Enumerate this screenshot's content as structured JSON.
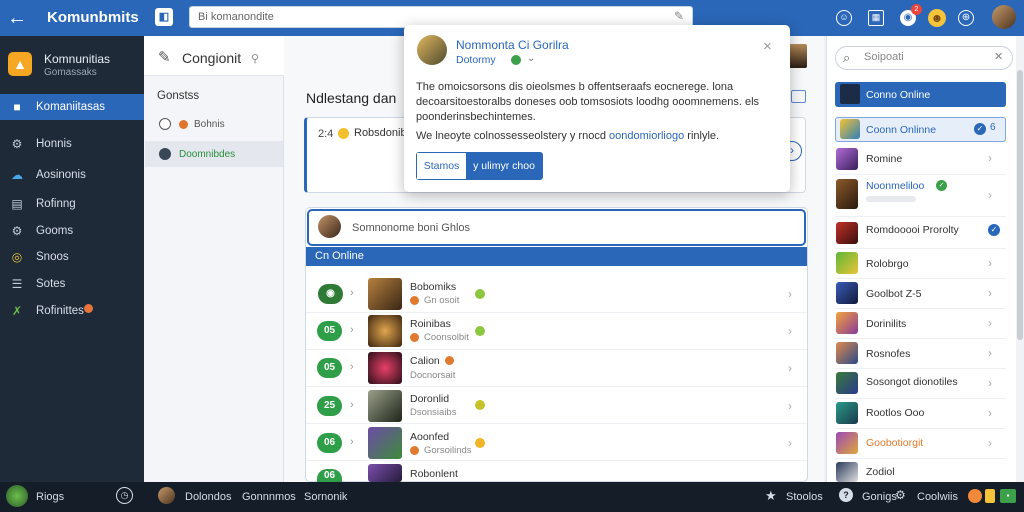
{
  "topbar": {
    "app_title": "Komunbmits",
    "search_placeholder": "Bi komanondite",
    "notification_count": "2",
    "colors": {
      "bar": "#2a67b8"
    }
  },
  "sidebar": {
    "brand_name": "Komnunitias",
    "brand_sub": "Gomassaks",
    "items": [
      {
        "label": "Komaniitasas",
        "icon": "group-icon",
        "active": true
      },
      {
        "label": "Honnis",
        "icon": "gear-icon"
      },
      {
        "label": "Aosinonis",
        "icon": "cloud-icon"
      },
      {
        "label": "Rofinng",
        "icon": "folder-icon"
      },
      {
        "label": "Gooms",
        "icon": "gear-icon"
      },
      {
        "label": "Snoos",
        "icon": "coin-icon"
      },
      {
        "label": "Sotes",
        "icon": "list-icon"
      },
      {
        "label": "Rofinittes",
        "icon": "wand-icon"
      }
    ]
  },
  "col2": {
    "title": "Congionit",
    "section": "Gonstss",
    "rows": [
      {
        "label": "Bohnis",
        "dot_color": "#e0762c"
      },
      {
        "label": "Doomnibdes",
        "dot_color": "#3a4756"
      }
    ]
  },
  "main": {
    "heading": "Ndlestang dan",
    "topcard": {
      "num": "2:4",
      "text": "Robsdonibks"
    },
    "list_search": "Somnonome boni Ghlos",
    "band": "Cn Online",
    "rows": [
      {
        "badge": "",
        "name": "Bobomiks",
        "sub": "Gn osoit",
        "dot": "#8dc63f"
      },
      {
        "badge": "05",
        "name": "Roinibas",
        "sub": "Coonsolbit",
        "dot": "#8dc63f"
      },
      {
        "badge": "05",
        "name": "Calion",
        "sub": "Docnorsait",
        "dot": ""
      },
      {
        "badge": "25",
        "name": "Doronlid",
        "sub": "Dsonsiaibs",
        "dot": "#c5c32a"
      },
      {
        "badge": "06",
        "name": "Aoonfed",
        "sub": "Gorsoilinds",
        "dot": "#f2b525"
      },
      {
        "badge": "06",
        "name": "Robonlent",
        "sub": "",
        "dot": ""
      }
    ]
  },
  "popup": {
    "title": "Nommonta Ci Gorilra",
    "sub": "Dotormy",
    "body": "The omoicsorsons dis oieolsmes b offentseraafs eocnerege. lona decoarsitoestoralbs doneses oob tomsosiots loodhg ooomnemens. els poonderinsbechintemes.",
    "line2_pre": "We lneoyte colnossesseolstery y rnocd ",
    "line2_link": "oondomiorliogo",
    "line2_post": " rinlyle.",
    "btn_left": "Stamos",
    "btn_right": "y ulimyr choo"
  },
  "rpanel": {
    "search_placeholder": "Soipoati",
    "items": [
      {
        "name": "Conno Online"
      },
      {
        "name": "Coonn Onlinne",
        "badge": "6"
      },
      {
        "name": "Romine"
      },
      {
        "name": "Noonmeliloo"
      },
      {
        "name": "Romdooooi Prorolty"
      },
      {
        "name": "Rolobrgo"
      },
      {
        "name": "Goolbot Z-5"
      },
      {
        "name": "Dorinilits"
      },
      {
        "name": "Rosnofes"
      },
      {
        "name": "Sosongot dionotiles"
      },
      {
        "name": "Rootlos Ooo"
      },
      {
        "name": "Goobotiorgit"
      },
      {
        "name": "Zodiol"
      }
    ]
  },
  "bottombar": {
    "left_label": "Riogs",
    "tabs": [
      "Dolondos",
      "Gonnnmos",
      "Sornonik"
    ],
    "right_items": [
      "Stoolos",
      "Gonigs",
      "Coolwiis"
    ]
  }
}
